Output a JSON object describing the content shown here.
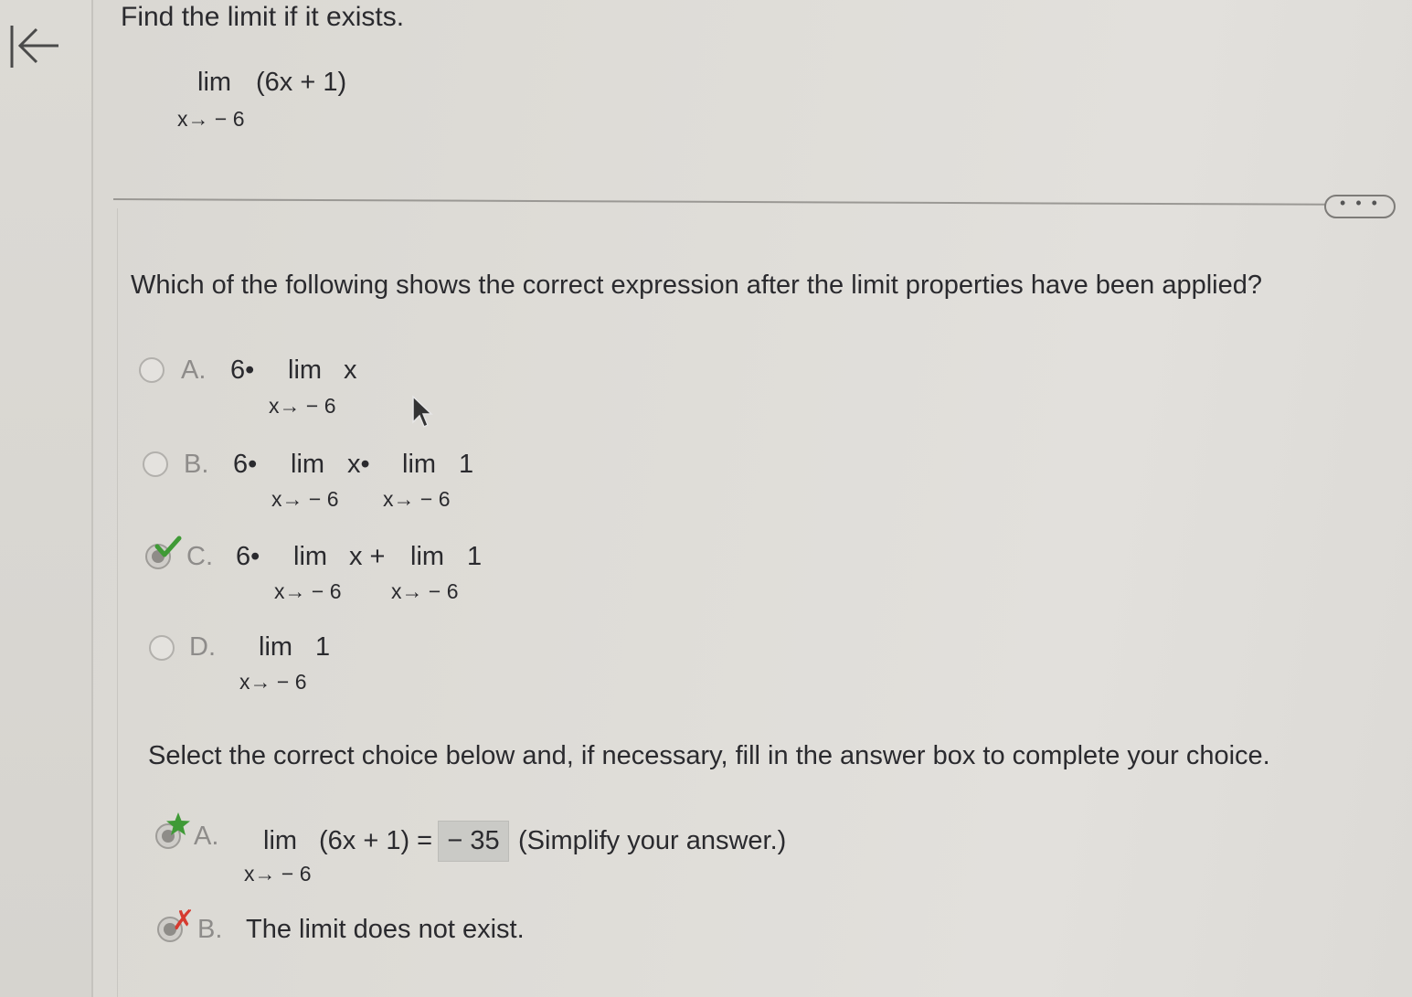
{
  "question": {
    "title": "Find the limit if it exists.",
    "limit": {
      "lim": "lim",
      "expr": "(6x + 1)",
      "sub": "x→ − 6"
    }
  },
  "more_button_label": "• • •",
  "part1": {
    "prompt": "Which of the following shows the correct expression after the limit properties have been applied?",
    "choices": [
      {
        "letter": "A.",
        "coef": "6•",
        "lim1": "lim",
        "term1": "x",
        "sub1": "x→ − 6"
      },
      {
        "letter": "B.",
        "coef": "6•",
        "lim1": "lim",
        "term1": "x•",
        "sub1": "x→ − 6",
        "lim2": "lim",
        "term2": "1",
        "sub2": "x→ − 6"
      },
      {
        "letter": "C.",
        "coef": "6•",
        "lim1": "lim",
        "term1": "x +",
        "sub1": "x→ − 6",
        "lim2": "lim",
        "term2": "1",
        "sub2": "x→ − 6",
        "status": "correct"
      },
      {
        "letter": "D.",
        "lim1": "lim",
        "term1": "1",
        "sub1": "x→ − 6"
      }
    ]
  },
  "part2": {
    "prompt": "Select the correct choice below and, if necessary, fill in the answer box to complete your choice.",
    "choice_a": {
      "letter": "A.",
      "lim": "lim",
      "expr": "(6x + 1) =",
      "sub": "x→ − 6",
      "answer": "− 35",
      "hint": "(Simplify your answer.)",
      "status": "correct-answer"
    },
    "choice_b": {
      "letter": "B.",
      "text": "The limit does not exist.",
      "status": "incorrect"
    }
  },
  "colors": {
    "check": "#3f9a36",
    "star": "#3f9a36",
    "cross": "#d63a2f",
    "answer_box": "#cacac6"
  }
}
